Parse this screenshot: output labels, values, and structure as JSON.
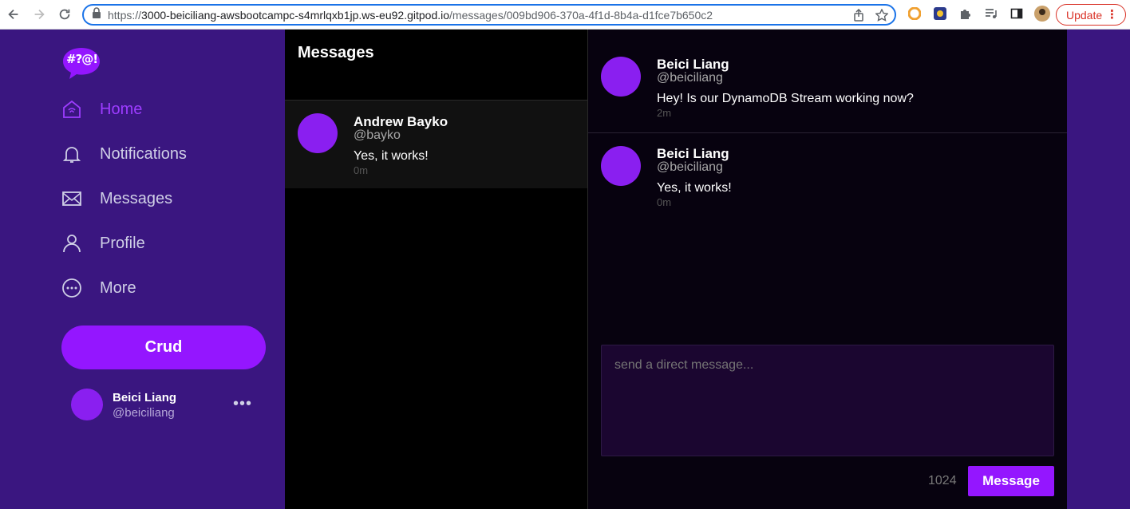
{
  "browser": {
    "url_prefix": "https://",
    "url_host": "3000-beiciliang-awsbootcampc-s4mrlqxb1jp.ws-eu92.gitpod.io",
    "url_path": "/messages/009bd906-370a-4f1d-8b4a-d1fce7b650c2",
    "update_label": "Update"
  },
  "sidebar": {
    "logo_text": "#?@!",
    "items": [
      {
        "label": "Home",
        "icon": "home-icon",
        "active": true
      },
      {
        "label": "Notifications",
        "icon": "bell-icon"
      },
      {
        "label": "Messages",
        "icon": "envelope-icon"
      },
      {
        "label": "Profile",
        "icon": "user-icon"
      },
      {
        "label": "More",
        "icon": "more-circle-icon"
      }
    ],
    "crud_label": "Crud",
    "profile": {
      "name": "Beici Liang",
      "handle": "@beiciliang",
      "more": "•••"
    }
  },
  "groups": {
    "title": "Messages",
    "items": [
      {
        "name": "Andrew Bayko",
        "handle": "@bayko",
        "text": "Yes, it works!",
        "time": "0m"
      }
    ]
  },
  "conversation": {
    "messages": [
      {
        "name": "Beici Liang",
        "handle": "@beiciliang",
        "text": "Hey! Is our DynamoDB Stream working now?",
        "time": "2m"
      },
      {
        "name": "Beici Liang",
        "handle": "@beiciliang",
        "text": "Yes, it works!",
        "time": "0m"
      }
    ],
    "compose_placeholder": "send a direct message...",
    "counter": "1024",
    "send_label": "Message"
  },
  "colors": {
    "accent": "#9416ff",
    "sidebar_bg": "#3a1680",
    "avatar": "#8a1ff0"
  }
}
